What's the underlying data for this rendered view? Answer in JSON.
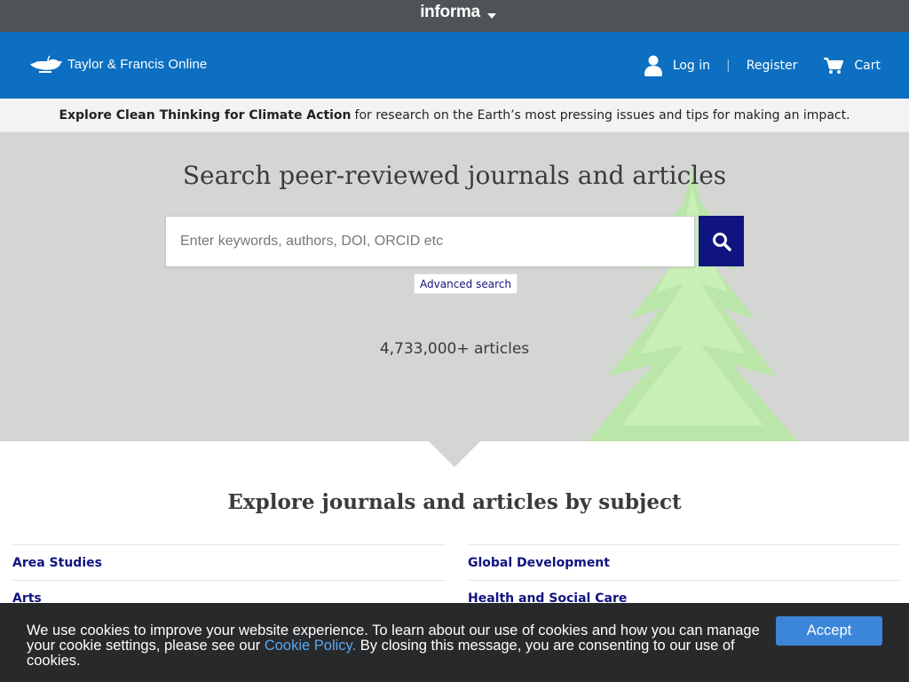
{
  "informa": {
    "logo_text": "informa"
  },
  "header": {
    "brand_name": "Taylor & Francis Online",
    "login_label": "Log in",
    "separator": "|",
    "register_label": "Register",
    "cart_label": "Cart"
  },
  "banner": {
    "link_text": "Explore Clean Thinking for Climate Action",
    "rest_text": "for research on the Earth’s most pressing issues and tips for making an impact."
  },
  "hero": {
    "title": "Search peer-reviewed journals and articles",
    "search_placeholder": "Enter keywords, authors, DOI, ORCID etc",
    "advanced_search_label": "Advanced search",
    "article_count": "4,733,000+ articles"
  },
  "subjects": {
    "title": "Explore journals and articles by subject",
    "left": [
      "Area Studies",
      "Arts"
    ],
    "right": [
      "Global Development",
      "Health and Social Care"
    ]
  },
  "cookie": {
    "text_before": "We use cookies to improve your website experience. To learn about our use of cookies and how you can manage your cookie settings, please see our ",
    "link_text": "Cookie Policy.",
    "text_after": " By closing this message, you are consenting to our use of cookies.",
    "accept_label": "Accept"
  },
  "colors": {
    "header_blue": "#0c6fc1",
    "informa_bar": "#4d5356",
    "search_button": "#10147e",
    "link_navy": "#10147e",
    "accept_button": "#3b86d9",
    "cookie_bg": "#28292b"
  },
  "icons": [
    "caret-down-icon",
    "lamp-logo-icon",
    "user-icon",
    "cart-icon",
    "search-icon"
  ]
}
